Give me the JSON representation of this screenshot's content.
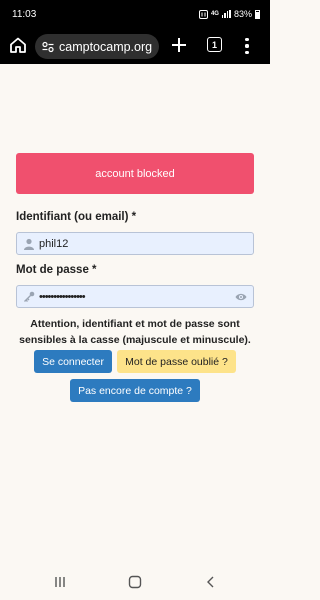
{
  "status_bar": {
    "time": "11:03",
    "network": "4G",
    "battery": "83%"
  },
  "browser": {
    "url": "camptocamp.org",
    "tab_count": "1"
  },
  "alert": {
    "message": "account blocked",
    "color": "#f0506e"
  },
  "login_form": {
    "username_label": "Identifiant (ou email) *",
    "username_value": "phil12",
    "password_label": "Mot de passe *",
    "password_value": "••••••••••••••••",
    "warning": "Attention, identifiant et mot de passe sont sensibles à la casse (majuscule et minuscule).",
    "login_button": "Se connecter",
    "forgot_button": "Mot de passe oublié ?",
    "register_button": "Pas encore de compte ?"
  },
  "colors": {
    "primary": "#2d7bbf",
    "warning_button": "#fde38a",
    "input_bg": "#e8f0fe",
    "page_bg": "#fbf8f3"
  }
}
